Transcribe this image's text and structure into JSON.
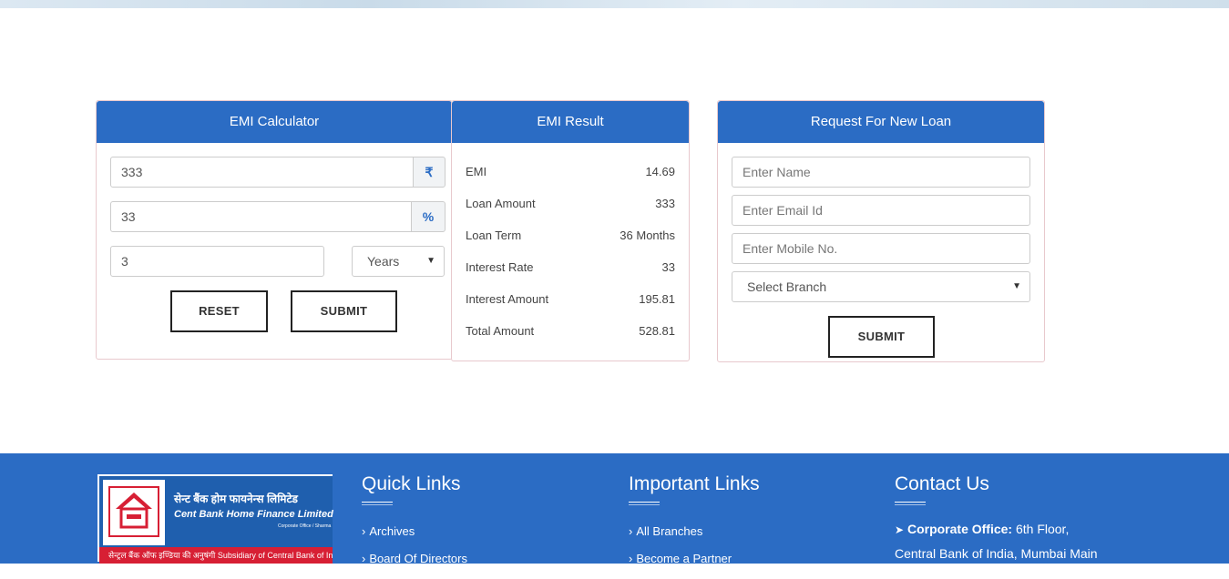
{
  "calculator": {
    "title": "EMI Calculator",
    "amount": "333",
    "amount_addon": "₹",
    "rate": "33",
    "rate_addon": "%",
    "term": "3",
    "term_unit": "Years",
    "reset_label": "RESET",
    "submit_label": "SUBMIT"
  },
  "result": {
    "title": "EMI Result",
    "rows": [
      {
        "label": "EMI",
        "value": "14.69"
      },
      {
        "label": "Loan Amount",
        "value": "333"
      },
      {
        "label": "Loan Term",
        "value": "36 Months"
      },
      {
        "label": "Interest Rate",
        "value": "33"
      },
      {
        "label": "Interest Amount",
        "value": "195.81"
      },
      {
        "label": "Total Amount",
        "value": "528.81"
      }
    ]
  },
  "loan_request": {
    "title": "Request For New Loan",
    "name_placeholder": "Enter Name",
    "email_placeholder": "Enter Email Id",
    "mobile_placeholder": "Enter Mobile No.",
    "branch_selected": "Select Branch",
    "submit_label": "SUBMIT"
  },
  "footer": {
    "logo": {
      "hindi": "सेन्ट बैंक होम फायनेन्स लिमिटेड",
      "english": "Cent Bank Home Finance Limited",
      "sub": "Corporate Office / Sharma",
      "tagline": "सेन्ट्रल बैंक ऑफ इण्डिया की अनुषंगी  Subsidiary of Central Bank of India"
    },
    "quick_links": {
      "title": "Quick Links",
      "items": [
        "Archives",
        "Board Of Directors"
      ]
    },
    "important_links": {
      "title": "Important Links",
      "items": [
        "All Branches",
        "Become a Partner"
      ]
    },
    "contact": {
      "title": "Contact Us",
      "label": "Corporate Office:",
      "line1": "6th Floor,",
      "line2": "Central Bank of India, Mumbai Main"
    }
  },
  "colors": {
    "primary": "#2b6cc4",
    "accent_red": "#d71f34"
  }
}
